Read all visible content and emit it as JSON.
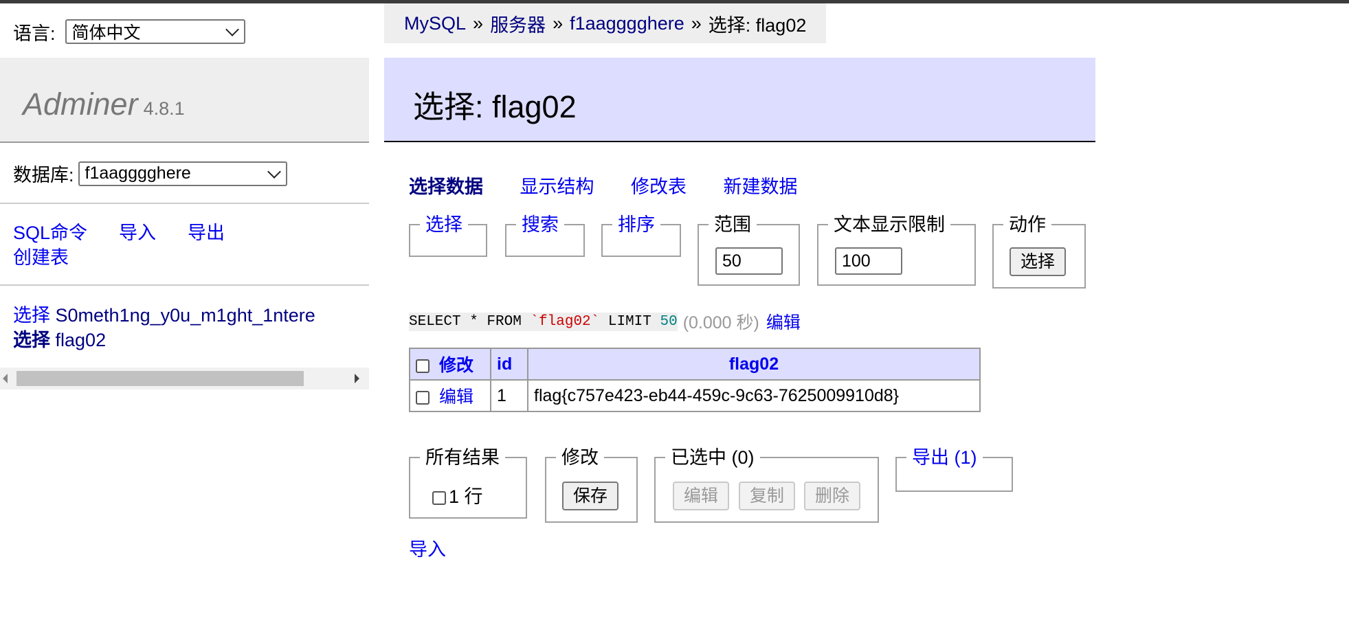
{
  "lang": {
    "label": "语言:",
    "selected": "简体中文"
  },
  "logo": {
    "name": "Adminer",
    "version": "4.8.1"
  },
  "database": {
    "label": "数据库:",
    "selected": "f1aagggghere"
  },
  "menu_links": [
    "SQL命令",
    "导入",
    "导出",
    "创建表"
  ],
  "tables": [
    {
      "select_label": "选择",
      "name": "S0meth1ng_y0u_m1ght_1ntere"
    },
    {
      "select_label": "选择",
      "name": "flag02"
    }
  ],
  "breadcrumb": {
    "items": [
      "MySQL",
      "服务器",
      "f1aagggghere"
    ],
    "sep": "»",
    "current": "选择: flag02"
  },
  "page_title": "选择: flag02",
  "subnav": [
    "选择数据",
    "显示结构",
    "修改表",
    "新建数据"
  ],
  "filters": {
    "select": "选择",
    "search": "搜索",
    "sort": "排序",
    "limit_label": "范围",
    "limit_value": "50",
    "text_limit_label": "文本显示限制",
    "text_limit_value": "100",
    "action_label": "动作",
    "action_button": "选择"
  },
  "sql": {
    "p1": "SELECT * FROM ",
    "table": "`flag02`",
    "p2": " LIMIT ",
    "limit": "50",
    "time": "(0.000 秒)",
    "edit": "编辑"
  },
  "table": {
    "headers": [
      "修改",
      "id",
      "flag02"
    ],
    "rows": [
      {
        "edit": "编辑",
        "id": "1",
        "flag02": "flag{c757e423-eb44-459c-9c63-7625009910d8}"
      }
    ]
  },
  "bottom": {
    "all_results_label": "所有结果",
    "rows_count": "1 行",
    "modify_label": "修改",
    "save_button": "保存",
    "selected_label": "已选中 (0)",
    "edit_button": "编辑",
    "copy_button": "复制",
    "delete_button": "删除",
    "export_label": "导出 (1)",
    "import_link": "导入"
  }
}
